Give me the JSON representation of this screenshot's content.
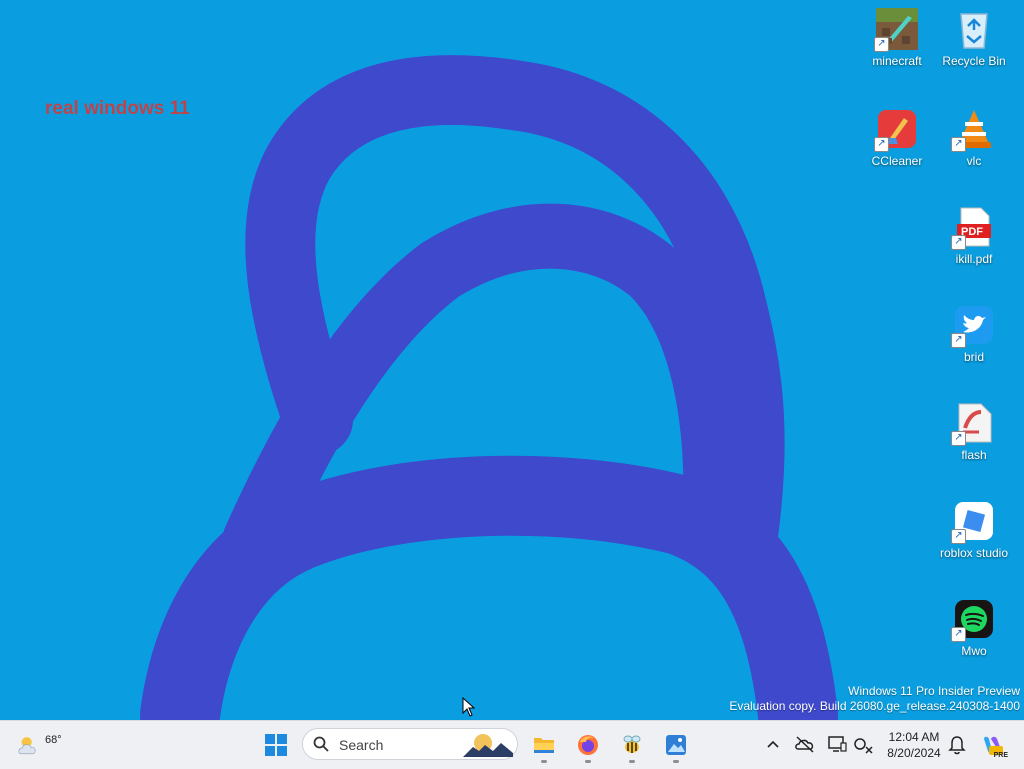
{
  "wallpaper": {
    "caption": "real windows 11"
  },
  "desktop_icons": [
    {
      "label": "minecraft",
      "icon": "minecraft-icon"
    },
    {
      "label": "Recycle Bin",
      "icon": "recycle-bin-icon"
    },
    {
      "label": "CCleaner",
      "icon": "ccleaner-icon"
    },
    {
      "label": "vlc",
      "icon": "vlc-icon"
    },
    {
      "label": "ikill.pdf",
      "icon": "pdf-icon",
      "badge": "PDF"
    },
    {
      "label": "brid",
      "icon": "bird-icon"
    },
    {
      "label": "flash",
      "icon": "flash-icon"
    },
    {
      "label": "roblox studio",
      "icon": "roblox-studio-icon"
    },
    {
      "label": "Mwo",
      "icon": "spotify-icon"
    }
  ],
  "watermark": {
    "line1": "Windows 11 Pro Insider Preview",
    "line2": "Evaluation copy. Build 26080.ge_release.240308-1400"
  },
  "taskbar": {
    "weather_temp": "68°",
    "search_placeholder": "Search",
    "pinned": [
      "start-icon",
      "file-explorer-icon",
      "firefox-icon",
      "bee-app-icon",
      "photos-icon"
    ],
    "tray": [
      "chevron-up-icon",
      "onedrive-icon",
      "display-icon",
      "network-icon"
    ],
    "time": "12:04 AM",
    "date": "8/20/2024",
    "copilot_badge": "PRE"
  },
  "colors": {
    "desktop": "#0a9ee0",
    "scribble": "#3e49cc",
    "taskbar": "#eef0f4",
    "caption": "#d23b3b"
  }
}
